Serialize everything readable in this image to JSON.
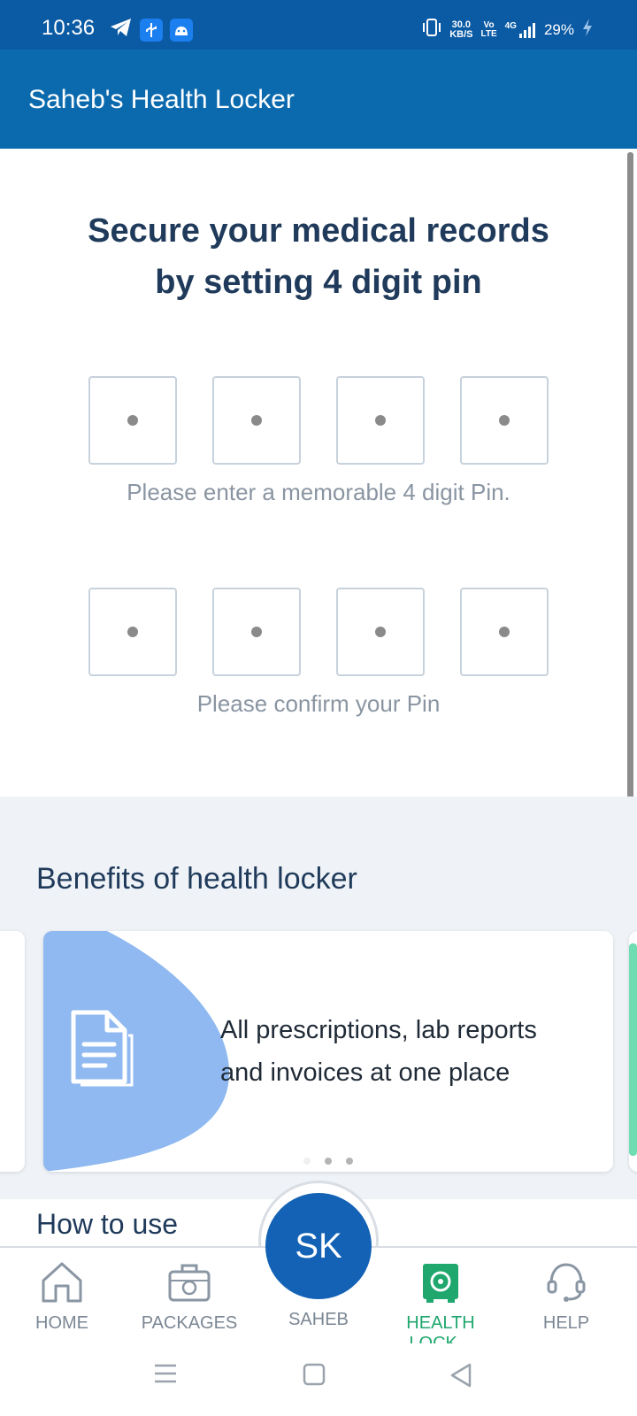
{
  "status_bar": {
    "time": "10:36",
    "net_speed_value": "30.0",
    "net_speed_unit": "KB/S",
    "volte_top": "Vo",
    "volte_bottom": "LTE",
    "network": "4G",
    "battery": "29%"
  },
  "app_bar": {
    "title": "Saheb's Health Locker"
  },
  "pin_setup": {
    "heading_line1": "Secure your medical records",
    "heading_line2": "by setting 4 digit pin",
    "enter_hint": "Please enter a memorable 4 digit Pin.",
    "confirm_hint": "Please confirm your Pin"
  },
  "benefits": {
    "title": "Benefits of health locker",
    "card_line1": "All prescriptions, lab reports",
    "card_line2": "and invoices at one place",
    "carousel_page": 1,
    "carousel_count": 3
  },
  "how_to_use": {
    "title": "How to use"
  },
  "bottom_nav": {
    "home": "HOME",
    "packages": "PACKAGES",
    "avatar_initials": "SK",
    "profile": "SAHEB",
    "health_locker": "HEALTH LOCK...",
    "help": "HELP",
    "active_color": "#1fa76e"
  },
  "colors": {
    "primary": "#0b6aae",
    "heading": "#1f3a5a",
    "avatar": "#1362b5",
    "card_blob": "#8fb9f0",
    "accent_green": "#6fdcb2"
  }
}
